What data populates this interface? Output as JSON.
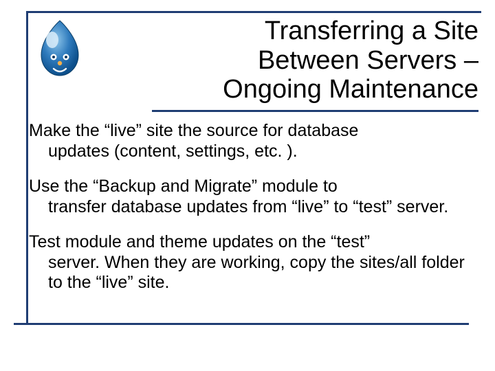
{
  "title": {
    "line1": "Transferring a Site",
    "line2": "Between Servers –",
    "line3": "Ongoing Maintenance"
  },
  "paragraphs": [
    {
      "first": "Make the “live” site the source for database",
      "rest": "updates (content, settings, etc. )."
    },
    {
      "first": "Use the “Backup and Migrate” module to",
      "rest": "transfer database updates from “live” to “test” server."
    },
    {
      "first": "Test module and theme updates on the “test”",
      "rest": "server. When they are working, copy the sites/all folder to the “live” site."
    }
  ],
  "logo_name": "drupal-logo"
}
